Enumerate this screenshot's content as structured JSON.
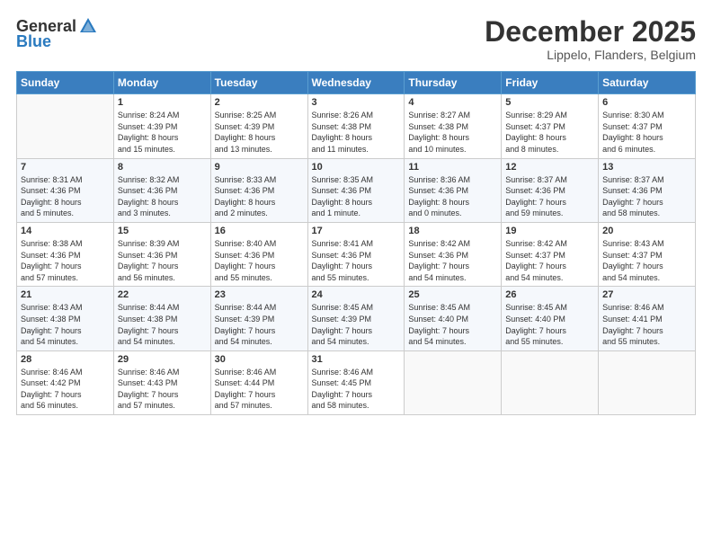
{
  "header": {
    "logo_general": "General",
    "logo_blue": "Blue",
    "month_title": "December 2025",
    "subtitle": "Lippelo, Flanders, Belgium"
  },
  "weekdays": [
    "Sunday",
    "Monday",
    "Tuesday",
    "Wednesday",
    "Thursday",
    "Friday",
    "Saturday"
  ],
  "weeks": [
    [
      {
        "day": "",
        "info": ""
      },
      {
        "day": "1",
        "info": "Sunrise: 8:24 AM\nSunset: 4:39 PM\nDaylight: 8 hours\nand 15 minutes."
      },
      {
        "day": "2",
        "info": "Sunrise: 8:25 AM\nSunset: 4:39 PM\nDaylight: 8 hours\nand 13 minutes."
      },
      {
        "day": "3",
        "info": "Sunrise: 8:26 AM\nSunset: 4:38 PM\nDaylight: 8 hours\nand 11 minutes."
      },
      {
        "day": "4",
        "info": "Sunrise: 8:27 AM\nSunset: 4:38 PM\nDaylight: 8 hours\nand 10 minutes."
      },
      {
        "day": "5",
        "info": "Sunrise: 8:29 AM\nSunset: 4:37 PM\nDaylight: 8 hours\nand 8 minutes."
      },
      {
        "day": "6",
        "info": "Sunrise: 8:30 AM\nSunset: 4:37 PM\nDaylight: 8 hours\nand 6 minutes."
      }
    ],
    [
      {
        "day": "7",
        "info": "Sunrise: 8:31 AM\nSunset: 4:36 PM\nDaylight: 8 hours\nand 5 minutes."
      },
      {
        "day": "8",
        "info": "Sunrise: 8:32 AM\nSunset: 4:36 PM\nDaylight: 8 hours\nand 3 minutes."
      },
      {
        "day": "9",
        "info": "Sunrise: 8:33 AM\nSunset: 4:36 PM\nDaylight: 8 hours\nand 2 minutes."
      },
      {
        "day": "10",
        "info": "Sunrise: 8:35 AM\nSunset: 4:36 PM\nDaylight: 8 hours\nand 1 minute."
      },
      {
        "day": "11",
        "info": "Sunrise: 8:36 AM\nSunset: 4:36 PM\nDaylight: 8 hours\nand 0 minutes."
      },
      {
        "day": "12",
        "info": "Sunrise: 8:37 AM\nSunset: 4:36 PM\nDaylight: 7 hours\nand 59 minutes."
      },
      {
        "day": "13",
        "info": "Sunrise: 8:37 AM\nSunset: 4:36 PM\nDaylight: 7 hours\nand 58 minutes."
      }
    ],
    [
      {
        "day": "14",
        "info": "Sunrise: 8:38 AM\nSunset: 4:36 PM\nDaylight: 7 hours\nand 57 minutes."
      },
      {
        "day": "15",
        "info": "Sunrise: 8:39 AM\nSunset: 4:36 PM\nDaylight: 7 hours\nand 56 minutes."
      },
      {
        "day": "16",
        "info": "Sunrise: 8:40 AM\nSunset: 4:36 PM\nDaylight: 7 hours\nand 55 minutes."
      },
      {
        "day": "17",
        "info": "Sunrise: 8:41 AM\nSunset: 4:36 PM\nDaylight: 7 hours\nand 55 minutes."
      },
      {
        "day": "18",
        "info": "Sunrise: 8:42 AM\nSunset: 4:36 PM\nDaylight: 7 hours\nand 54 minutes."
      },
      {
        "day": "19",
        "info": "Sunrise: 8:42 AM\nSunset: 4:37 PM\nDaylight: 7 hours\nand 54 minutes."
      },
      {
        "day": "20",
        "info": "Sunrise: 8:43 AM\nSunset: 4:37 PM\nDaylight: 7 hours\nand 54 minutes."
      }
    ],
    [
      {
        "day": "21",
        "info": "Sunrise: 8:43 AM\nSunset: 4:38 PM\nDaylight: 7 hours\nand 54 minutes."
      },
      {
        "day": "22",
        "info": "Sunrise: 8:44 AM\nSunset: 4:38 PM\nDaylight: 7 hours\nand 54 minutes."
      },
      {
        "day": "23",
        "info": "Sunrise: 8:44 AM\nSunset: 4:39 PM\nDaylight: 7 hours\nand 54 minutes."
      },
      {
        "day": "24",
        "info": "Sunrise: 8:45 AM\nSunset: 4:39 PM\nDaylight: 7 hours\nand 54 minutes."
      },
      {
        "day": "25",
        "info": "Sunrise: 8:45 AM\nSunset: 4:40 PM\nDaylight: 7 hours\nand 54 minutes."
      },
      {
        "day": "26",
        "info": "Sunrise: 8:45 AM\nSunset: 4:40 PM\nDaylight: 7 hours\nand 55 minutes."
      },
      {
        "day": "27",
        "info": "Sunrise: 8:46 AM\nSunset: 4:41 PM\nDaylight: 7 hours\nand 55 minutes."
      }
    ],
    [
      {
        "day": "28",
        "info": "Sunrise: 8:46 AM\nSunset: 4:42 PM\nDaylight: 7 hours\nand 56 minutes."
      },
      {
        "day": "29",
        "info": "Sunrise: 8:46 AM\nSunset: 4:43 PM\nDaylight: 7 hours\nand 57 minutes."
      },
      {
        "day": "30",
        "info": "Sunrise: 8:46 AM\nSunset: 4:44 PM\nDaylight: 7 hours\nand 57 minutes."
      },
      {
        "day": "31",
        "info": "Sunrise: 8:46 AM\nSunset: 4:45 PM\nDaylight: 7 hours\nand 58 minutes."
      },
      {
        "day": "",
        "info": ""
      },
      {
        "day": "",
        "info": ""
      },
      {
        "day": "",
        "info": ""
      }
    ]
  ]
}
